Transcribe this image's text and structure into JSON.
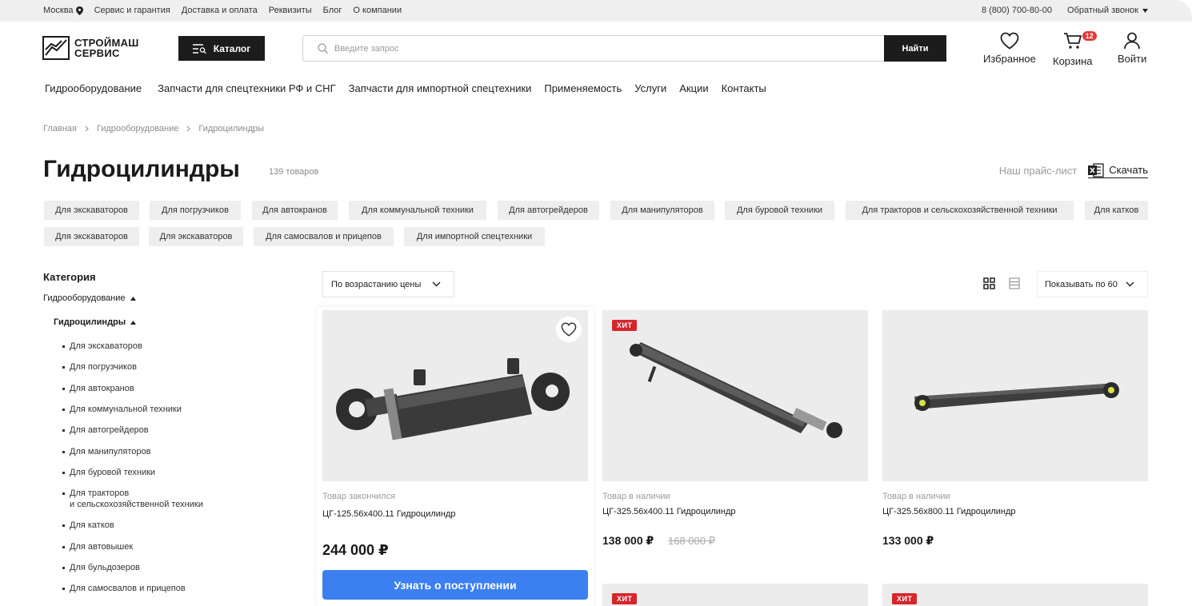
{
  "topbar": {
    "city": "Москва",
    "links": [
      "Сервис и гарантия",
      "Доставка и оплата",
      "Реквизиты",
      "Блог",
      "О компании"
    ],
    "phone": "8 (800) 700-80-00",
    "callback": "Обратный звонок"
  },
  "header": {
    "logo_line1": "СТРОЙМАШ",
    "logo_line2": "СЕРВИС",
    "catalog_label": "Каталог",
    "search_placeholder": "Введите запрос",
    "find_label": "Найти",
    "favorites_label": "Избранное",
    "cart_label": "Корзина",
    "cart_count": "12",
    "login_label": "Войти"
  },
  "mainnav": [
    "Гидрооборудование",
    "Запчасти для спецтехники РФ и СНГ",
    "Запчасти для импортной спецтехники",
    "Применяемость",
    "Услуги",
    "Акции",
    "Контакты"
  ],
  "breadcrumb": [
    "Главная",
    "Гидрооборудование",
    "Гидроцилиндры"
  ],
  "page": {
    "title": "Гидроцилиндры",
    "count": "139 товаров",
    "pricelist_label": "Наш прайс-лист",
    "download_label": "Скачать"
  },
  "chips": [
    "Для экскаваторов",
    "Для погрузчиков",
    "Для автокранов",
    "Для коммунальной техники",
    "Для автогрейдеров",
    "Для манипуляторов",
    "Для буровой техники",
    "Для тракторов и сельскохозяйственной техники",
    "Для катков",
    "Для экскаваторов",
    "Для экскаваторов",
    "Для самосвалов и прицепов",
    "Для импортной спецтехники"
  ],
  "sidebar": {
    "title": "Категория",
    "level1": "Гидрооборудование",
    "level2": "Гидроцилиндры",
    "items": [
      "Для экскаваторов",
      "Для погрузчиков",
      "Для автокранов",
      "Для коммунальной техники",
      "Для автогрейдеров",
      "Для манипуляторов",
      "Для буровой техники",
      "Для тракторов",
      "и сельскохозяйственной техники",
      "Для катков",
      "Для автовышек",
      "Для бульдозеров",
      "Для самосвалов и прицепов"
    ]
  },
  "toolbar": {
    "sort_label": "По возрастанию цены",
    "perpage_label": "Показывать по 60"
  },
  "products": [
    {
      "stock": "Товар закончился",
      "name": "ЦГ-125.56х400.11 Гидроцилиндр",
      "price": "244 000 ₽",
      "button": "Узнать о поступлении"
    },
    {
      "badge": "ХИТ",
      "stock": "Товар в наличии",
      "name": "ЦГ-325.56х400.11 Гидроцилиндр",
      "price": "138 000 ₽",
      "old_price": "168 000 ₽"
    },
    {
      "stock": "Товар в наличии",
      "name": "ЦГ-325.56х800.11 Гидроцилиндр",
      "price": "133 000 ₽"
    }
  ],
  "next_row_badges": [
    "ХИТ",
    "ХИТ"
  ],
  "icons": {
    "city": "location-pin-icon",
    "callback": "chevron-down-icon",
    "catalog": "menu-search-icon",
    "search": "search-icon",
    "favorites": "heart-icon",
    "cart": "cart-icon",
    "login": "user-icon",
    "excel": "excel-icon",
    "grid": "grid-view-icon",
    "list": "list-view-icon"
  },
  "colors": {
    "accent_blue": "#3c7ff0",
    "hit_red": "#d7252c",
    "dark": "#1c1c1c"
  }
}
